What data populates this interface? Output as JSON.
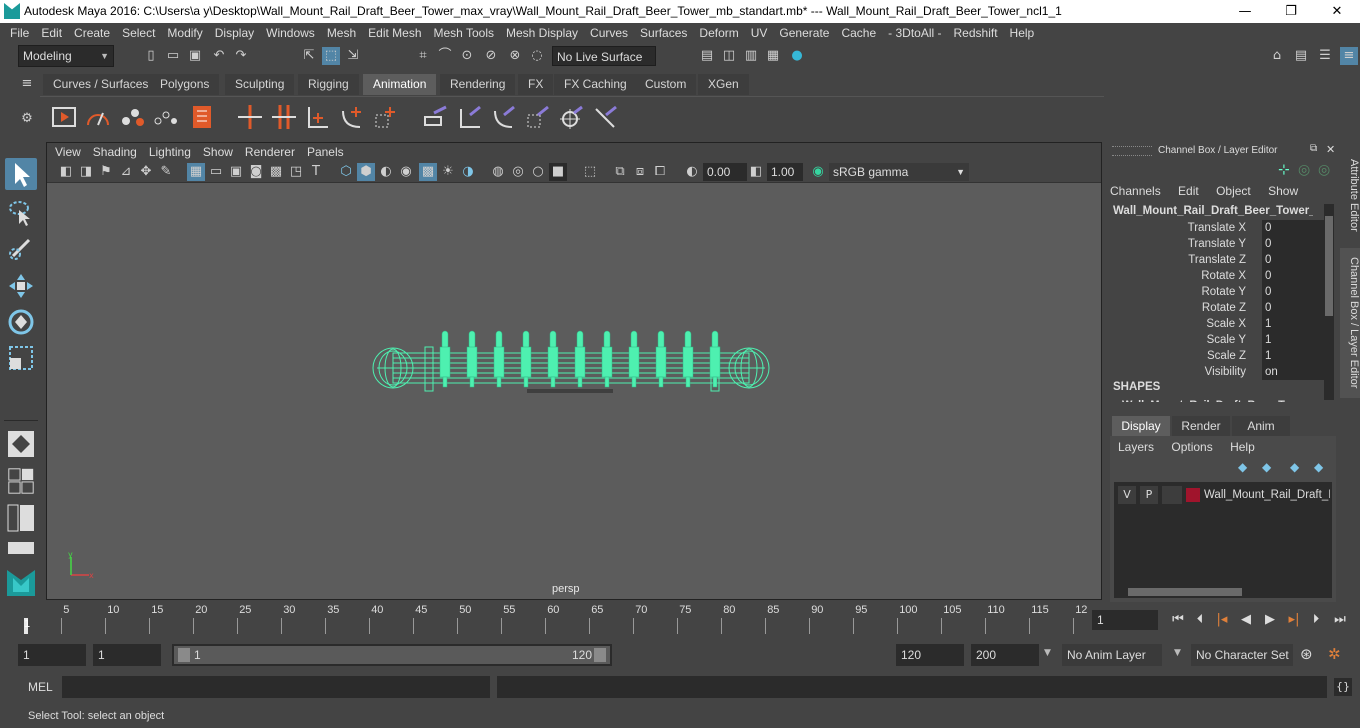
{
  "titlebar": {
    "title": "Autodesk Maya 2016: C:\\Users\\a y\\Desktop\\Wall_Mount_Rail_Draft_Beer_Tower_max_vray\\Wall_Mount_Rail_Draft_Beer_Tower_mb_standart.mb*   ---   Wall_Mount_Rail_Draft_Beer_Tower_ncl1_1",
    "minimize": "—",
    "maximize": "❐",
    "close": "✕"
  },
  "menubar": [
    "File",
    "Edit",
    "Create",
    "Select",
    "Modify",
    "Display",
    "Windows",
    "Mesh",
    "Edit Mesh",
    "Mesh Tools",
    "Mesh Display",
    "Curves",
    "Surfaces",
    "Deform",
    "UV",
    "Generate",
    "Cache",
    "- 3DtoAll -",
    "Redshift",
    "Help"
  ],
  "statusline": {
    "mode": "Modeling",
    "live_surface": "No Live Surface"
  },
  "shelf_tabs": [
    "Curves / Surfaces",
    "Polygons",
    "Sculpting",
    "Rigging",
    "Animation",
    "Rendering",
    "FX",
    "FX Caching",
    "Custom",
    "XGen"
  ],
  "active_shelf": "Animation",
  "viewport": {
    "menu": [
      "View",
      "Shading",
      "Lighting",
      "Show",
      "Renderer",
      "Panels"
    ],
    "exposure": "0.00",
    "gamma": "1.00",
    "color_space": "sRGB gamma",
    "camera": "persp",
    "wire_color": "#4ef0b0"
  },
  "channel_box": {
    "title": "Channel Box / Layer Editor",
    "menu": [
      "Channels",
      "Edit",
      "Object",
      "Show"
    ],
    "object_name": "Wall_Mount_Rail_Draft_Beer_Tower_n...",
    "channels": [
      {
        "label": "Translate X",
        "value": "0"
      },
      {
        "label": "Translate Y",
        "value": "0"
      },
      {
        "label": "Translate Z",
        "value": "0"
      },
      {
        "label": "Rotate X",
        "value": "0"
      },
      {
        "label": "Rotate Y",
        "value": "0"
      },
      {
        "label": "Rotate Z",
        "value": "0"
      },
      {
        "label": "Scale X",
        "value": "1"
      },
      {
        "label": "Scale Y",
        "value": "1"
      },
      {
        "label": "Scale Z",
        "value": "1"
      },
      {
        "label": "Visibility",
        "value": "on"
      }
    ],
    "shapes_header": "SHAPES",
    "shapes_item": "Wall_Mount_Rail_Draft_Beer_Tower...",
    "layer_tabs": [
      "Display",
      "Render",
      "Anim"
    ],
    "layer_menu": [
      "Layers",
      "Options",
      "Help"
    ],
    "layer": {
      "v": "V",
      "p": "P",
      "name": "Wall_Mount_Rail_Draft_I",
      "color": "#a0142c"
    }
  },
  "side_tabs": {
    "attribute_editor": "Attribute Editor",
    "channel_box": "Channel Box / Layer Editor"
  },
  "timeline": {
    "ticks": [
      "5",
      "10",
      "15",
      "20",
      "25",
      "30",
      "35",
      "40",
      "45",
      "50",
      "55",
      "60",
      "65",
      "70",
      "75",
      "80",
      "85",
      "90",
      "95",
      "100",
      "105",
      "110",
      "115",
      "12"
    ],
    "start_marker": "1",
    "current_frame": "1"
  },
  "range": {
    "start": "1",
    "playback_start": "1",
    "slider_start": "1",
    "slider_end": "120",
    "playback_end": "120",
    "end": "200",
    "anim_layer": "No Anim Layer",
    "character_set": "No Character Set"
  },
  "command": {
    "label": "MEL"
  },
  "helpline": "Select Tool: select an object"
}
